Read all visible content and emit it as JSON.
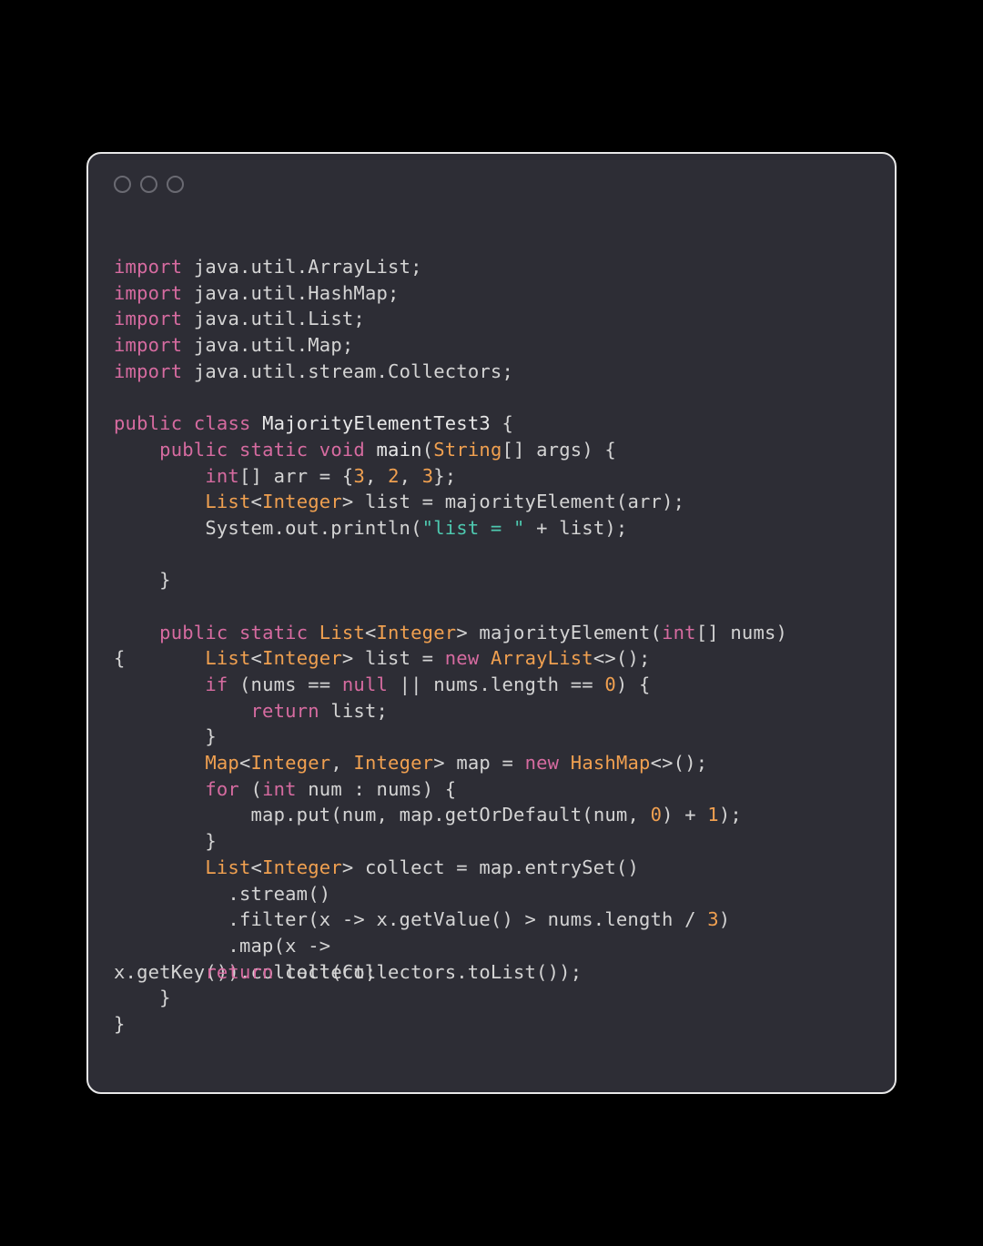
{
  "code": {
    "imports": [
      {
        "kw": "import",
        "pkg": "java.util.ArrayList"
      },
      {
        "kw": "import",
        "pkg": "java.util.HashMap"
      },
      {
        "kw": "import",
        "pkg": "java.util.List"
      },
      {
        "kw": "import",
        "pkg": "java.util.Map"
      },
      {
        "kw": "import",
        "pkg": "java.util.stream.Collectors"
      }
    ],
    "classDecl": {
      "kw_public": "public",
      "kw_class": "class",
      "name": "MajorityElementTest3"
    },
    "mainMethod": {
      "kw_public": "public",
      "kw_static": "static",
      "kw_void": "void",
      "name": "main",
      "paramType": "String",
      "paramName": "args",
      "line1": {
        "kw_int": "int",
        "arrName": "arr",
        "vals": [
          "3",
          "2",
          "3"
        ]
      },
      "line2": {
        "type": "List",
        "generic": "Integer",
        "var": "list",
        "call": "majorityElement",
        "arg": "arr"
      },
      "line3": {
        "obj": "System.out.println",
        "str": "\"list = \"",
        "plus": "+",
        "var": "list"
      }
    },
    "majorityMethod": {
      "kw_public": "public",
      "kw_static": "static",
      "retType": "List",
      "retGeneric": "Integer",
      "name": "majorityElement",
      "paramType": "int",
      "paramName": "nums",
      "line1": {
        "type": "List",
        "generic": "Integer",
        "var": "list",
        "kw_new": "new",
        "ctor": "ArrayList"
      },
      "line2": {
        "kw_if": "if",
        "var": "nums",
        "kw_null": "null",
        "prop": "nums.length",
        "zero": "0"
      },
      "line3": {
        "kw_return": "return",
        "var": "list"
      },
      "line4": {
        "type": "Map",
        "g1": "Integer",
        "g2": "Integer",
        "var": "map",
        "kw_new": "new",
        "ctor": "HashMap"
      },
      "line5": {
        "kw_for": "for",
        "kw_int": "int",
        "var": "num",
        "iter": "nums"
      },
      "line6": {
        "obj": "map.put",
        "a1": "num",
        "obj2": "map.getOrDefault",
        "a2": "num",
        "zero": "0",
        "one": "1"
      },
      "line7": {
        "type": "List",
        "generic": "Integer",
        "var": "collect",
        "call": "map.entrySet"
      },
      "line8": ".stream()",
      "line9": {
        "call": ".filter",
        "lambda": "x -> x.getValue() > nums.length / ",
        "three": "3"
      },
      "line10": ".map(x ->",
      "line11a": "x.getKey())",
      "line11b_ret": "return",
      "line11b_var": "collect;",
      "line11c": ".collect(Collectors.toList());"
    }
  }
}
